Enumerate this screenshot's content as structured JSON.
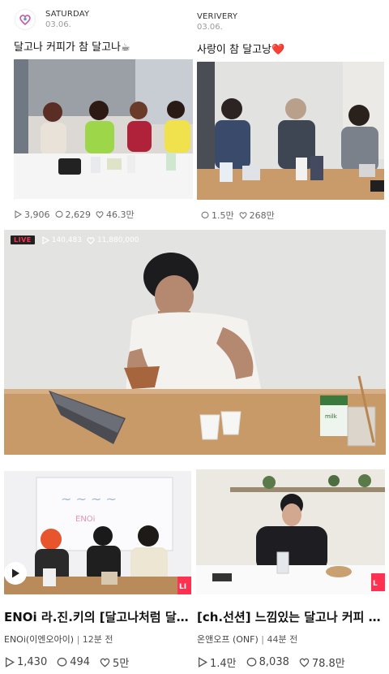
{
  "posts": [
    {
      "channel": "SATURDAY",
      "date": "03.06.",
      "title": "달고나 커피가 참 달고나☕",
      "stats": {
        "plays": "3,906",
        "comments": "2,629",
        "likes": "46.3만"
      }
    },
    {
      "channel": "VERIVERY",
      "date": "03.06.",
      "title": "사랑이 참 달고낭❤️",
      "stats": {
        "comments": "1.5만",
        "likes": "268만"
      }
    }
  ],
  "live": {
    "badge": "LIVE",
    "viewers": "140,483",
    "hearts": "11,880,000"
  },
  "videos": [
    {
      "title": "ENOi 라.진.키의 [달고나처럼 달…",
      "channel": "ENOi(이엔오아이)",
      "time": "12분 전",
      "stats": {
        "plays": "1,430",
        "comments": "494",
        "likes": "5만"
      }
    },
    {
      "title": "[ch.선션] 느낌있는 달고나 커피 …",
      "channel": "온앤오프 (ONF)",
      "time": "44분 전",
      "stats": {
        "plays": "1.4만",
        "comments": "8,038",
        "likes": "78.8만"
      }
    }
  ],
  "colors": {
    "live_red": "#ff3050",
    "text": "#111111",
    "muted": "#8a8a8a"
  }
}
